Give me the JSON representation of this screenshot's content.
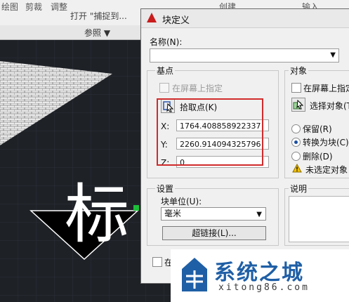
{
  "ribbon": {
    "tabs": [
      "绘图",
      "剪裁",
      "调整",
      "创建",
      "输入"
    ],
    "row_text": "打开 \"捕捉到...",
    "panel_label": "参照 ▼"
  },
  "drawing": {
    "big_char": "标"
  },
  "dialog": {
    "title": "块定义",
    "name_label": "名称(N):",
    "name_value": "",
    "basepoint": {
      "group_label": "基点",
      "onscreen_label": "在屏幕上指定",
      "pick_label": "拾取点(K)",
      "x_label": "X:",
      "x_value": "1764.408858922337",
      "y_label": "Y:",
      "y_value": "2260.914094325796",
      "z_label": "Z:",
      "z_value": "0"
    },
    "objects": {
      "group_label": "对象",
      "onscreen_label": "在屏幕上指定",
      "select_label": "选择对象(T)",
      "retain_label": "保留(R)",
      "convert_label": "转换为块(C)",
      "delete_label": "删除(D)",
      "warning": "未选定对象"
    },
    "settings": {
      "group_label": "设置",
      "unit_label": "块单位(U):",
      "unit_value": "毫米",
      "hyperlink_label": "超链接(L)..."
    },
    "description": {
      "group_label": "说明"
    },
    "bottom_checkbox_label": "在"
  },
  "watermark": {
    "text": "系统之城",
    "url": "xitong86.com"
  }
}
